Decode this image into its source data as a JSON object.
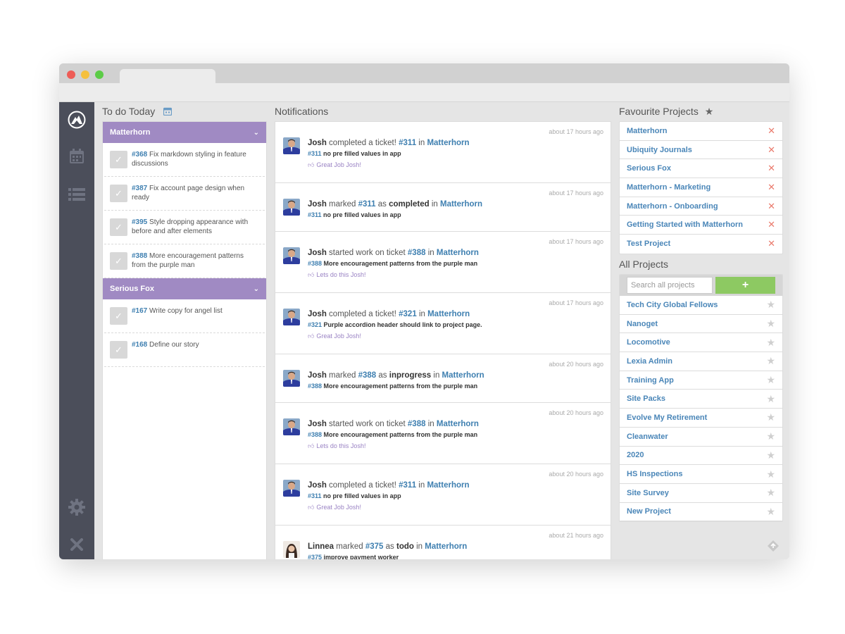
{
  "colors": {
    "purple": "#a08ac3",
    "link": "#3e7fb0",
    "sidebar": "#4b4e5a",
    "green": "#8dc962",
    "remove": "#ea7a6c"
  },
  "nav": {
    "icons": [
      "logo-icon",
      "calendar-icon",
      "list-icon",
      "gear-icon",
      "close-icon"
    ]
  },
  "todo": {
    "title": "To do Today",
    "groups": [
      {
        "name": "Matterhorn",
        "items": [
          {
            "num": "#368",
            "text": "Fix markdown styling in feature discussions"
          },
          {
            "num": "#387",
            "text": "Fix account page design when ready"
          },
          {
            "num": "#395",
            "text": "Style dropping appearance with before and after elements"
          },
          {
            "num": "#388",
            "text": "More encouragement patterns from the purple man"
          }
        ]
      },
      {
        "name": "Serious Fox",
        "items": [
          {
            "num": "#167",
            "text": "Write copy for angel list"
          },
          {
            "num": "#168",
            "text": "Define our story"
          }
        ]
      }
    ]
  },
  "notifications": {
    "title": "Notifications",
    "items": [
      {
        "time": "about 17 hours ago",
        "user": "Josh",
        "pre": "completed a ticket!",
        "ticket": "#311",
        "mid": "in",
        "status": "",
        "project": "Matterhorn",
        "sub_num": "#311",
        "sub_text": "no pre filled values in app",
        "kudo": "Great Job Josh!"
      },
      {
        "time": "about 17 hours ago",
        "user": "Josh",
        "pre": "marked",
        "ticket": "#311",
        "mid": "as",
        "status": "completed",
        "project": "Matterhorn",
        "sub_num": "#311",
        "sub_text": "no pre filled values in app",
        "kudo": ""
      },
      {
        "time": "about 17 hours ago",
        "user": "Josh",
        "pre": "started work on ticket",
        "ticket": "#388",
        "mid": "in",
        "status": "",
        "project": "Matterhorn",
        "sub_num": "#388",
        "sub_text": "More encouragement patterns from the purple man",
        "kudo": "Lets do this Josh!"
      },
      {
        "time": "about 17 hours ago",
        "user": "Josh",
        "pre": "completed a ticket!",
        "ticket": "#321",
        "mid": "in",
        "status": "",
        "project": "Matterhorn",
        "sub_num": "#321",
        "sub_text": "Purple accordion header should link to project page.",
        "kudo": "Great Job Josh!"
      },
      {
        "time": "about 20 hours ago",
        "user": "Josh",
        "pre": "marked",
        "ticket": "#388",
        "mid": "as",
        "status": "inprogress",
        "project": "Matterhorn",
        "sub_num": "#388",
        "sub_text": "More encouragement patterns from the purple man",
        "kudo": ""
      },
      {
        "time": "about 20 hours ago",
        "user": "Josh",
        "pre": "started work on ticket",
        "ticket": "#388",
        "mid": "in",
        "status": "",
        "project": "Matterhorn",
        "sub_num": "#388",
        "sub_text": "More encouragement patterns from the purple man",
        "kudo": "Lets do this Josh!"
      },
      {
        "time": "about 20 hours ago",
        "user": "Josh",
        "pre": "completed a ticket!",
        "ticket": "#311",
        "mid": "in",
        "status": "",
        "project": "Matterhorn",
        "sub_num": "#311",
        "sub_text": "no pre filled values in app",
        "kudo": "Great Job Josh!"
      },
      {
        "time": "about 21 hours ago",
        "user": "Linnea",
        "pre": "marked",
        "ticket": "#375",
        "mid": "as",
        "status": "todo",
        "project": "Matterhorn",
        "sub_num": "#375",
        "sub_text": "improve payment worker",
        "kudo": ""
      }
    ]
  },
  "favourites": {
    "title": "Favourite Projects",
    "items": [
      "Matterhorn",
      "Ubiquity Journals",
      "Serious Fox",
      "Matterhorn - Marketing",
      "Matterhorn - Onboarding",
      "Getting Started with Matterhorn",
      "Test Project"
    ]
  },
  "all_projects": {
    "title": "All Projects",
    "search_placeholder": "Search all projects",
    "add_label": "+",
    "items": [
      "Tech City Global Fellows",
      "Nanoget",
      "Locomotive",
      "Lexia Admin",
      "Training App",
      "Site Packs",
      "Evolve My Retirement",
      "Cleanwater",
      "2020",
      "HS Inspections",
      "Site Survey",
      "New Project"
    ]
  }
}
